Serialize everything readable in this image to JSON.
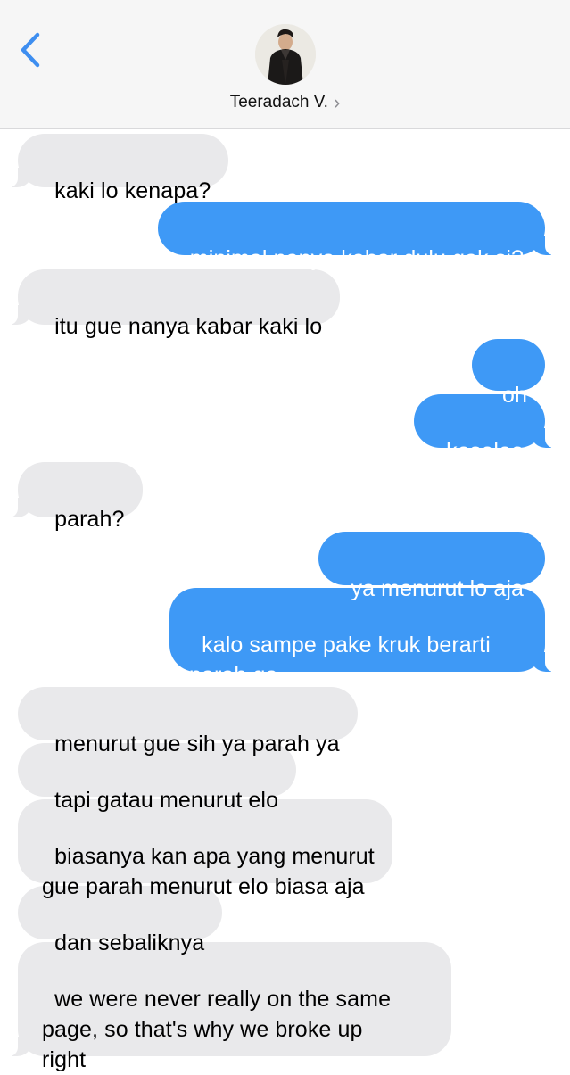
{
  "header": {
    "contact_name": "Teeradach V.",
    "chevron": "›",
    "back_icon": "chevron-left-icon",
    "accent_color": "#3e99f6"
  },
  "messages": [
    {
      "from": "contact",
      "text": "kaki lo kenapa?"
    },
    {
      "from": "me",
      "text": "minimal nanya kabar dulu gak si?"
    },
    {
      "from": "contact",
      "text": "itu gue nanya kabar kaki lo"
    },
    {
      "from": "me",
      "text": "oh"
    },
    {
      "from": "me",
      "text": "keseleo"
    },
    {
      "from": "contact",
      "text": "parah?"
    },
    {
      "from": "me",
      "text": "ya menurut lo aja"
    },
    {
      "from": "me",
      "text": "kalo sampe pake kruk berarti\nparah ga"
    },
    {
      "from": "contact",
      "text": "menurut gue sih ya parah ya"
    },
    {
      "from": "contact",
      "text": "tapi gatau menurut elo"
    },
    {
      "from": "contact",
      "text": "biasanya kan apa yang menurut\ngue parah menurut elo biasa aja"
    },
    {
      "from": "contact",
      "text": "dan sebaliknya"
    },
    {
      "from": "contact",
      "text": "we were never really on the same\npage, so that's why we broke up\nright"
    }
  ]
}
